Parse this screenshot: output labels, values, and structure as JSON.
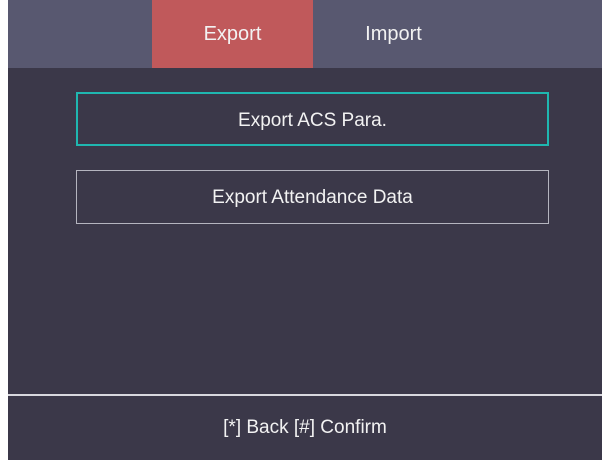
{
  "tabs": [
    {
      "label": "Export",
      "active": true
    },
    {
      "label": "Import",
      "active": false
    }
  ],
  "menu": {
    "items": [
      {
        "label": "Export ACS Para.",
        "selected": true
      },
      {
        "label": "Export Attendance Data",
        "selected": false
      }
    ]
  },
  "footer": {
    "hint": "[*] Back [#] Confirm"
  },
  "colors": {
    "background": "#3b3849",
    "tab_bar": "#585870",
    "active_tab": "#c0595b",
    "selection_border": "#1fb7b0",
    "item_border": "#b5b5bf"
  }
}
